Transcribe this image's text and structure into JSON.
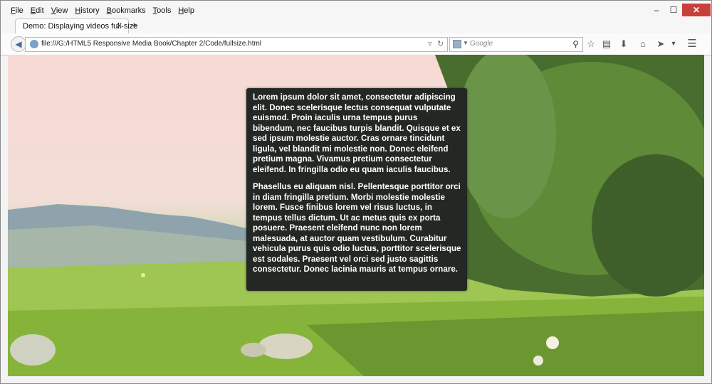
{
  "menu": [
    "File",
    "Edit",
    "View",
    "History",
    "Bookmarks",
    "Tools",
    "Help"
  ],
  "window_controls": {
    "minimize": "–",
    "maximize": "☐",
    "close": "✕"
  },
  "tab": {
    "title": "Demo: Displaying videos full-size",
    "close": "✕"
  },
  "new_tab": "+",
  "nav": {
    "url": "file:///G:/HTML5 Responsive Media Book/Chapter 2/Code/fullsize.html",
    "search_placeholder": "Google"
  },
  "icons": [
    "back-arrow-icon",
    "globe-icon",
    "dropdown-icon",
    "reload-icon",
    "search-engine-icon",
    "search-icon",
    "star-icon",
    "reading-list-icon",
    "download-icon",
    "home-icon",
    "share-icon",
    "menu-icon"
  ],
  "article": {
    "paragraphs": [
      "Lorem ipsum dolor sit amet, consectetur adipiscing elit. Donec scelerisque lectus consequat vulputate euismod. Proin iaculis urna tempus purus bibendum, nec faucibus turpis blandit. Quisque et ex sed ipsum molestie auctor. Cras ornare tincidunt ligula, vel blandit mi molestie non. Donec eleifend pretium magna. Vivamus pretium consectetur eleifend. In fringilla odio eu quam iaculis faucibus.",
      "Phasellus eu aliquam nisl. Pellentesque porttitor orci in diam fringilla pretium. Morbi molestie molestie lorem. Fusce finibus lorem vel risus luctus, in tempus tellus dictum. Ut ac metus quis ex porta posuere. Praesent eleifend nunc non lorem malesuada, at auctor quam vestibulum. Curabitur vehicula purus quis odio luctus, porttitor scelerisque est sodales. Praesent vel orci sed justo sagittis consectetur. Donec lacinia mauris at tempus ornare."
    ]
  },
  "colors": {
    "overlay_bg": "#242824",
    "close_red": "#c7413a",
    "sky": "#f7d9d4",
    "grass": "#8dbb45"
  }
}
